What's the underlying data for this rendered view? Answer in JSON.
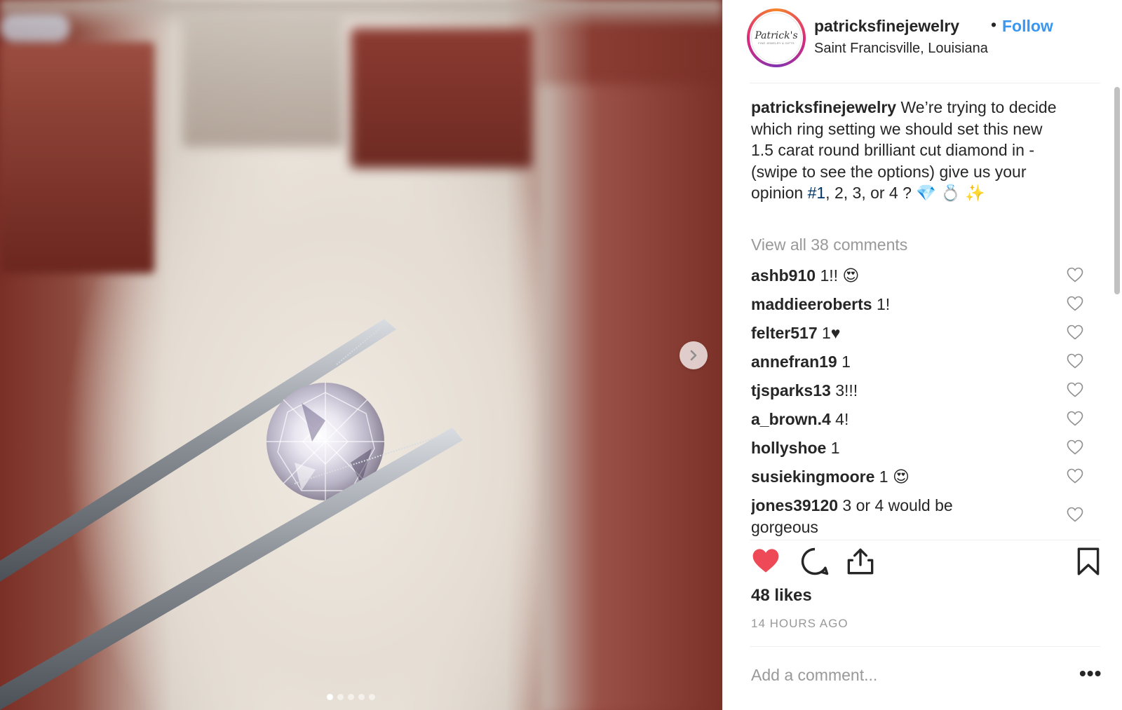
{
  "post": {
    "username": "patricksfinejewelry",
    "follow_label": "Follow",
    "separator": "•",
    "location": "Saint Francisville, Louisiana",
    "avatar": {
      "logo_text": "Patrick's",
      "logo_sub": "FINE JEWELRY & GIFTS"
    },
    "caption": {
      "username": "patricksfinejewelry",
      "text_before_hashtag": "We’re trying to decide which ring setting we should set this new 1.5 carat round brilliant cut diamond in - (swipe to see the options) give us your opinion ",
      "hashtag": "#1",
      "text_after_hashtag": ", 2, 3, or 4 ? 💎 💍 ✨"
    },
    "view_all_comments": "View all 38 comments",
    "comments": [
      {
        "user": "ashb910",
        "text": "1!! 😍"
      },
      {
        "user": "maddieeroberts",
        "text": "1!"
      },
      {
        "user": "felter517",
        "text": "1♥"
      },
      {
        "user": "annefran19",
        "text": "1"
      },
      {
        "user": "tjsparks13",
        "text": "3!!!"
      },
      {
        "user": "a_brown.4",
        "text": "4!"
      },
      {
        "user": "hollyshoe",
        "text": "1"
      },
      {
        "user": "susiekingmoore",
        "text": "1 😍"
      },
      {
        "user": "jones39120",
        "text": "3 or 4 would be gorgeous"
      }
    ],
    "likes": "48 likes",
    "timestamp": "14 HOURS AGO",
    "add_comment_placeholder": "Add a comment...",
    "more_label": "•••",
    "carousel": {
      "slides": 5,
      "active_index": 0
    }
  },
  "colors": {
    "link_blue": "#3897f0",
    "like_red": "#ed4956",
    "hashtag_blue": "#003569",
    "muted_gray": "#999999",
    "text": "#262626"
  },
  "icons": {
    "next": "chevron-right-icon",
    "like": "heart-filled-icon",
    "comment": "speech-bubble-icon",
    "share": "share-upload-icon",
    "save": "bookmark-icon",
    "comment_like": "heart-outline-icon"
  }
}
